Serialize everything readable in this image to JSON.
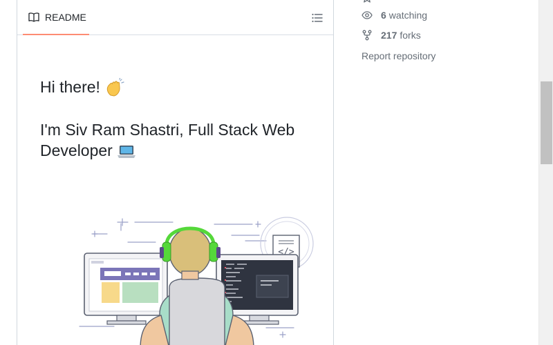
{
  "readme": {
    "tab_label": "README",
    "greeting": "Hi there!",
    "intro": "I'm Siv Ram Shastri, Full Stack Web Developer"
  },
  "sidebar": {
    "watching_count": "6",
    "watching_label": "watching",
    "forks_count": "217",
    "forks_label": "forks",
    "report_label": "Report repository"
  },
  "colors": {
    "tab_underline": "#fd8c73",
    "headphones": "#55d83a",
    "muted_text": "#656d76"
  },
  "icons": [
    "book-icon",
    "list-icon",
    "eye-icon",
    "fork-icon",
    "star-icon",
    "wave-emoji",
    "laptop-emoji"
  ]
}
